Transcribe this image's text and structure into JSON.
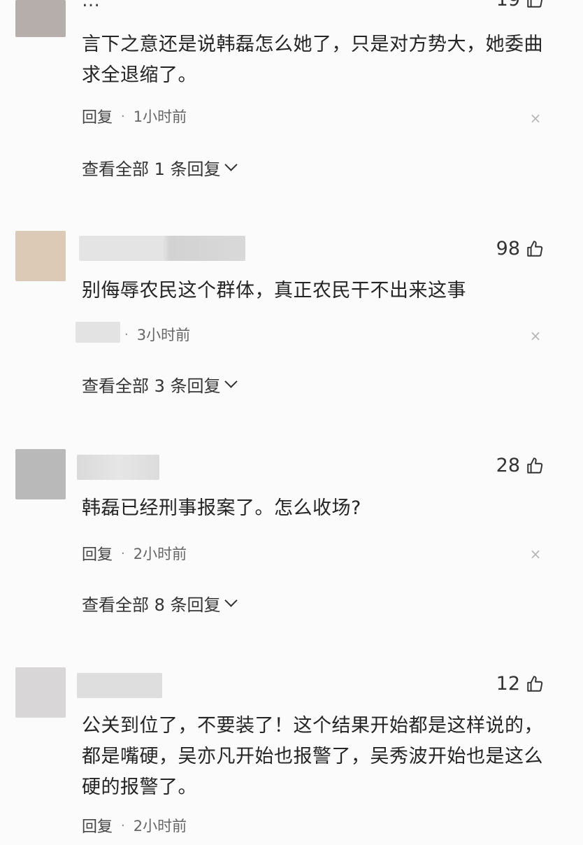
{
  "top_partial": {
    "text_fragment": "…",
    "likes_fragment": "19"
  },
  "comments": [
    {
      "avatar_color": "#b6aeaa",
      "body": "言下之意还是说韩磊怎么她了，只是对方势大，她委曲求全退缩了。",
      "reply_label": "回复",
      "time": "1小时前",
      "view_all": "查看全部 1 条回复"
    },
    {
      "avatar_color": "#ddcab6",
      "likes": "98",
      "body": "别侮辱农民这个群体，真正农民干不出来这事",
      "reply_label": "",
      "time": "3小时前",
      "view_all": "查看全部 3 条回复"
    },
    {
      "avatar_color": "#b9b9b9",
      "likes": "28",
      "body": "韩磊已经刑事报案了。怎么收场?",
      "reply_label": "回复",
      "time": "2小时前",
      "view_all": "查看全部 8 条回复"
    },
    {
      "avatar_color": "#d8d6d7",
      "likes": "12",
      "body": "公关到位了，不要装了！这个结果开始都是这样说的，都是嘴硬，吴亦凡开始也报警了，吴秀波开始也是这么硬的报警了。",
      "reply_label": "回复",
      "time": "2小时前"
    }
  ],
  "separator": "·",
  "close_glyph": "×"
}
